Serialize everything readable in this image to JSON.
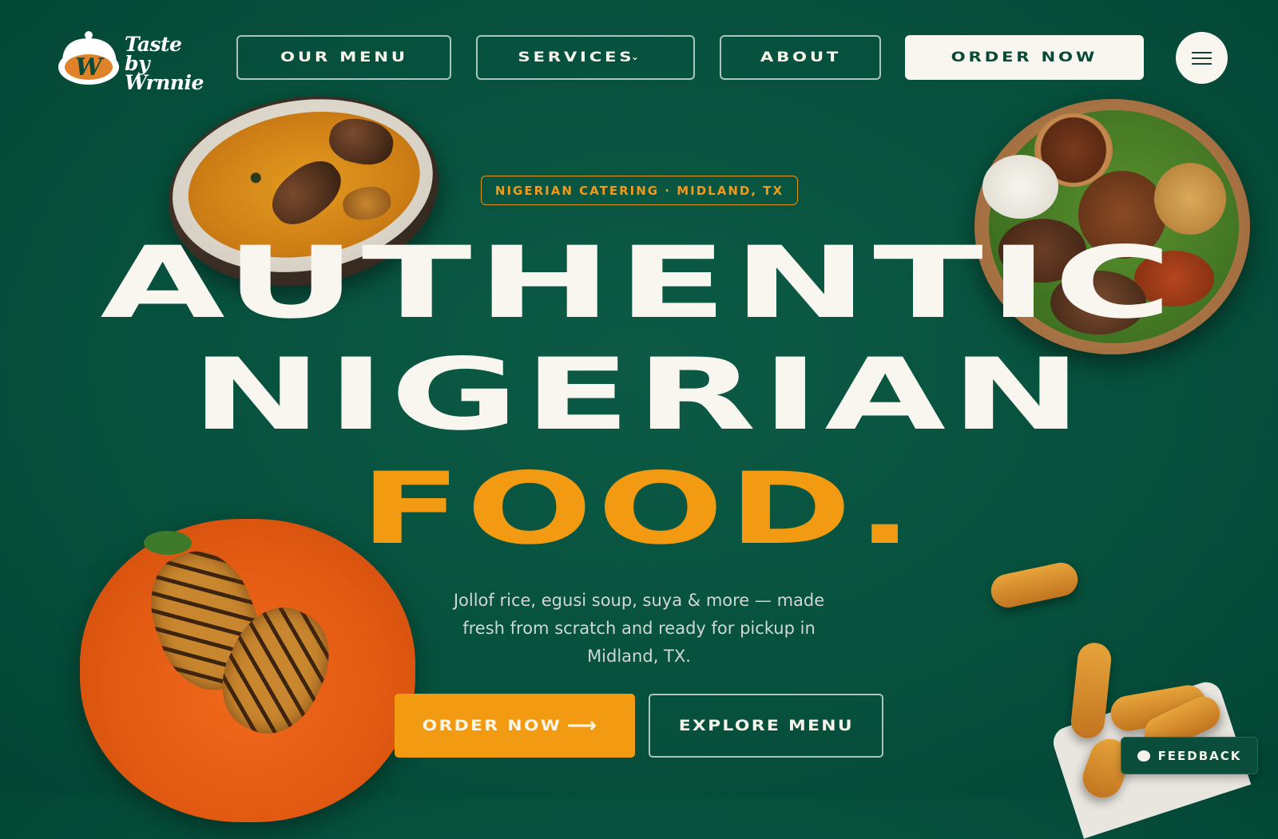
{
  "brand": {
    "logo_line1": "Taste by",
    "logo_line2": "Wrnnie",
    "logo_initial": "W"
  },
  "nav": {
    "menu_label": "OUR MENU",
    "services_label": "SERVICES",
    "about_label": "ABOUT",
    "order_label": "ORDER NOW"
  },
  "hero": {
    "badge": "NIGERIAN CATERING · MIDLAND, TX",
    "line1": "AUTHENTIC",
    "line2": "NIGERIAN",
    "line3": "FOOD.",
    "subcopy": "Jollof rice, egusi soup, suya & more — made fresh from scratch and ready for pickup in Midland, TX.",
    "cta_order": "ORDER NOW",
    "cta_explore": "EXPLORE MENU"
  },
  "feedback": {
    "label": "FEEDBACK"
  },
  "colors": {
    "background": "#06513d",
    "accent": "#f29a12",
    "cream": "#f8f6ef"
  },
  "icons": [
    "chevron-down-icon",
    "hamburger-icon",
    "arrow-right-icon",
    "chat-bubble-icon"
  ]
}
